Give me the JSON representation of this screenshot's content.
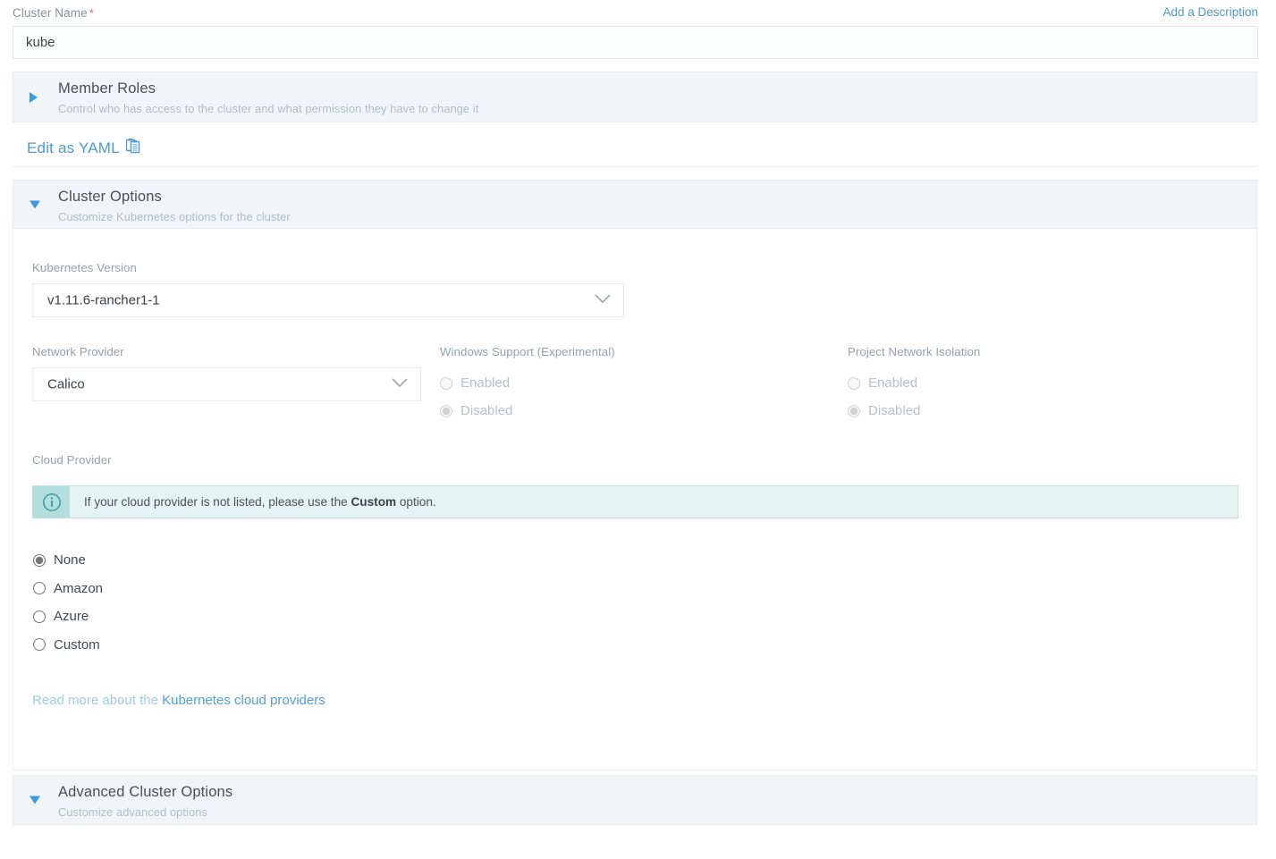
{
  "cluster_name": {
    "label": "Cluster Name",
    "required_marker": "*",
    "value": "kube",
    "placeholder": "",
    "add_description_link": "Add a Description"
  },
  "sections": [
    {
      "name": "member-roles",
      "title": "Member Roles",
      "subtitle": "Control who has access to the cluster and what permission they have to change it",
      "expanded": false,
      "arrow_icon": "triangle-right-icon"
    },
    {
      "name": "cluster-options",
      "title": "Cluster Options",
      "subtitle": "Customize Kubernetes options for the cluster",
      "expanded": true,
      "arrow_icon": "triangle-down-icon"
    },
    {
      "name": "advanced-cluster-options",
      "title": "Advanced Cluster Options",
      "subtitle": "Customize advanced options",
      "expanded": true,
      "arrow_icon": "triangle-down-icon"
    }
  ],
  "yaml": {
    "label": "Edit as YAML",
    "icon": "copy-documents-icon"
  },
  "cluster_options": {
    "kubernetes_version": {
      "label": "Kubernetes Version",
      "value": "v1.11.6-rancher1-1",
      "chevron_icon": "chevron-down-icon"
    },
    "network_provider": {
      "label": "Network Provider",
      "value": "Calico",
      "chevron_icon": "chevron-down-icon"
    },
    "windows_support": {
      "label": "Windows Support (Experimental)",
      "disabled": true,
      "options": [
        {
          "label": "Enabled",
          "selected": false
        },
        {
          "label": "Disabled",
          "selected": true
        }
      ]
    },
    "project_network_isolation": {
      "label": "Project Network Isolation",
      "disabled": true,
      "options": [
        {
          "label": "Enabled",
          "selected": false
        },
        {
          "label": "Disabled",
          "selected": true
        }
      ]
    },
    "cloud_provider": {
      "label": "Cloud Provider",
      "banner": {
        "icon": "info-circle-icon",
        "text_before": "If your cloud provider is not listed, please use the ",
        "text_bold": "Custom",
        "text_after": " option."
      },
      "options": [
        {
          "label": "None",
          "selected": true
        },
        {
          "label": "Amazon",
          "selected": false
        },
        {
          "label": "Azure",
          "selected": false
        },
        {
          "label": "Custom",
          "selected": false
        }
      ],
      "read_more_prefix": "Read more about the ",
      "read_more_link": "Kubernetes cloud providers"
    }
  },
  "colors": {
    "link_blue": "#4c98d0",
    "accent_arrow": "#3d9ae0",
    "header_bg": "#f1f5f7",
    "info_bg": "#e6f3f3",
    "info_icon_bg": "#b4dede",
    "info_border": "#bfdfe0",
    "required_red": "#e8635c"
  }
}
